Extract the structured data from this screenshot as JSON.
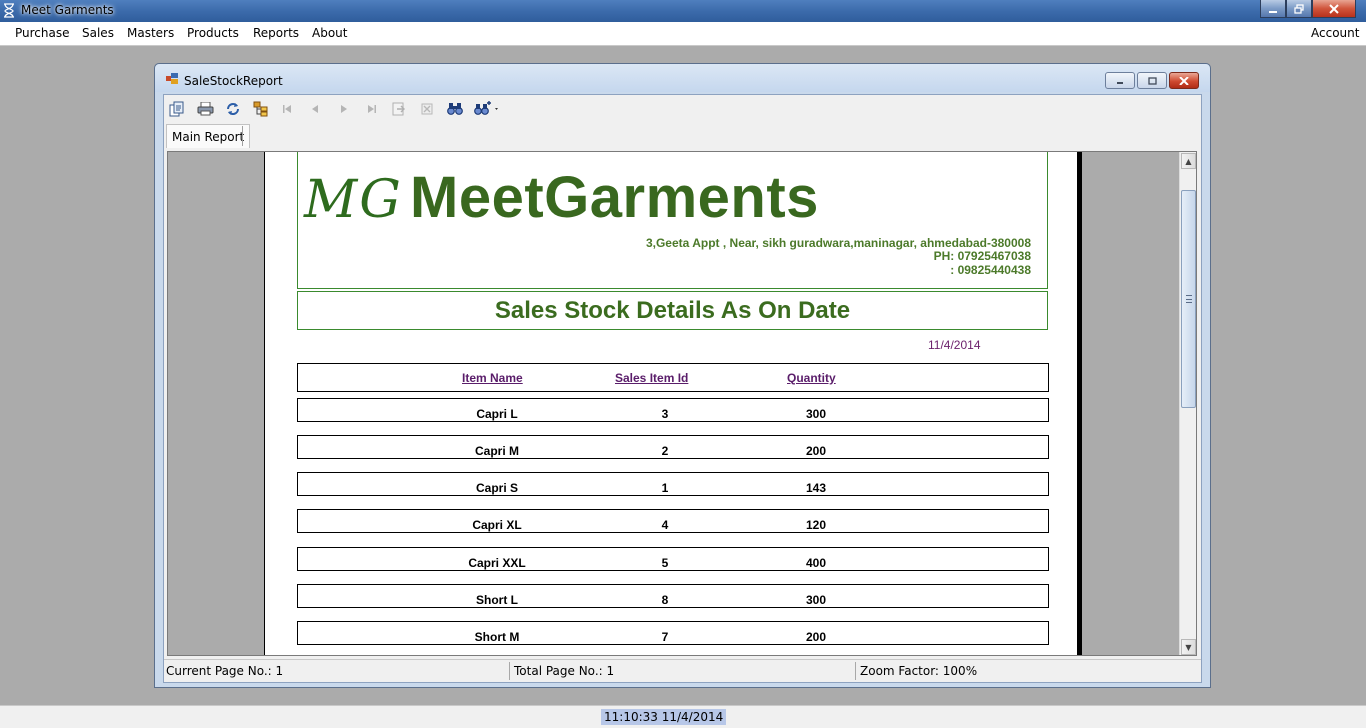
{
  "app": {
    "title": "Meet Garments"
  },
  "menubar": {
    "items": [
      "Purchase",
      "Sales",
      "Masters",
      "Products",
      "Reports",
      "About"
    ],
    "account": "Account"
  },
  "child": {
    "title": "SaleStockReport",
    "tab_label": "Main Report"
  },
  "toolbar": {
    "icons": [
      "export-icon",
      "print-icon",
      "refresh-icon",
      "group-tree-icon",
      "first-page-icon",
      "previous-page-icon",
      "next-page-icon",
      "last-page-icon",
      "goto-page-icon",
      "stop-icon",
      "find-icon",
      "zoom-icon"
    ]
  },
  "report": {
    "logo_text": "MG",
    "brand": "MeetGarments",
    "address_line1": "3,Geeta Appt , Near, sikh guradwara,maninagar, ahmedabad-380008",
    "address_line2": "PH: 07925467038",
    "address_line3": ": 09825440438",
    "title": "Sales Stock Details As On Date",
    "date": "11/4/2014",
    "columns": [
      "Item Name",
      "Sales Item Id",
      "Quantity"
    ],
    "rows": [
      {
        "item_name": "Capri L",
        "sales_item_id": "3",
        "quantity": "300"
      },
      {
        "item_name": "Capri M",
        "sales_item_id": "2",
        "quantity": "200"
      },
      {
        "item_name": "Capri S",
        "sales_item_id": "1",
        "quantity": "143"
      },
      {
        "item_name": "Capri XL",
        "sales_item_id": "4",
        "quantity": "120"
      },
      {
        "item_name": "Capri XXL",
        "sales_item_id": "5",
        "quantity": "400"
      },
      {
        "item_name": "Short L",
        "sales_item_id": "8",
        "quantity": "300"
      },
      {
        "item_name": "Short M",
        "sales_item_id": "7",
        "quantity": "200"
      }
    ]
  },
  "statusbar": {
    "current_page": "Current Page No.: 1",
    "total_page": "Total Page No.: 1",
    "zoom": "Zoom Factor: 100%"
  },
  "clock": "11:10:33 11/4/2014",
  "colors": {
    "brand_green": "#39681f",
    "header_purple": "#5a1d6a",
    "date_purple": "#6b1f6b"
  }
}
